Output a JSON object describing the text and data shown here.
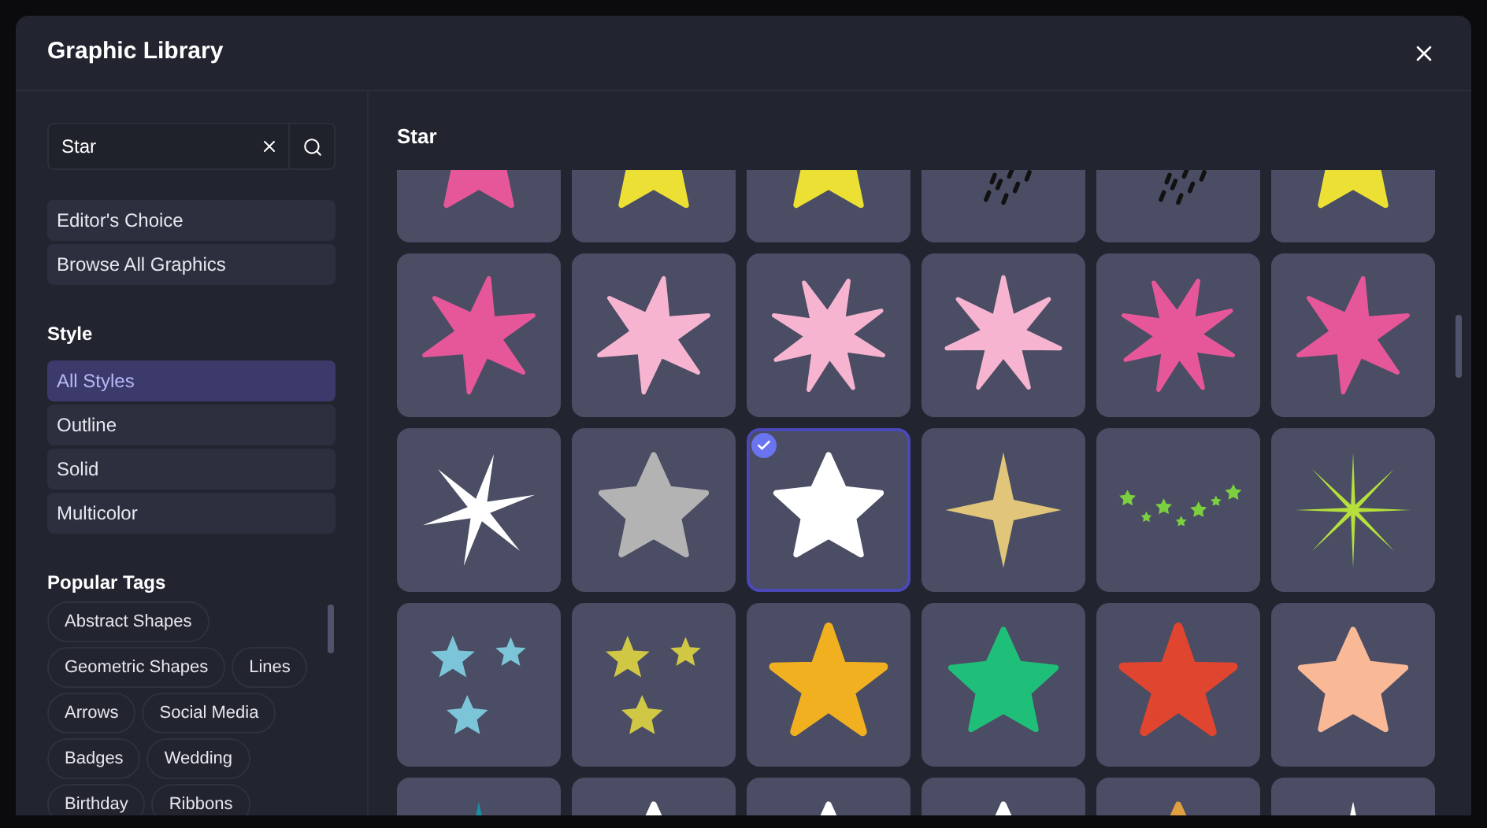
{
  "window": {
    "title": "Graphic Library"
  },
  "search": {
    "value": "Star"
  },
  "collections": [
    {
      "label": "Editor's Choice"
    },
    {
      "label": "Browse All Graphics"
    }
  ],
  "style_heading": "Style",
  "styles": [
    {
      "label": "All Styles",
      "selected": true
    },
    {
      "label": "Outline",
      "selected": false
    },
    {
      "label": "Solid",
      "selected": false
    },
    {
      "label": "Multicolor",
      "selected": false
    }
  ],
  "tags_heading": "Popular Tags",
  "tags": [
    "Abstract Shapes",
    "Geometric Shapes",
    "Lines",
    "Arrows",
    "Social Media",
    "Badges",
    "Wedding",
    "Birthday",
    "Ribbons"
  ],
  "results_title": "Star",
  "tiles": [
    {
      "kind": "star5",
      "color": "#e6579a",
      "selected": false
    },
    {
      "kind": "star5",
      "color": "#ede035",
      "selected": false
    },
    {
      "kind": "star5",
      "color": "#ede035",
      "selected": false
    },
    {
      "kind": "dashes",
      "color": "#111111",
      "selected": false
    },
    {
      "kind": "dashes",
      "color": "#111111",
      "selected": false
    },
    {
      "kind": "star5",
      "color": "#ede035",
      "selected": false
    },
    {
      "kind": "star6",
      "color": "#e6579a",
      "selected": false
    },
    {
      "kind": "star6",
      "color": "#f7b4d0",
      "selected": false
    },
    {
      "kind": "star8",
      "color": "#f7b4d0",
      "selected": false
    },
    {
      "kind": "star7",
      "color": "#f7b4d0",
      "selected": false
    },
    {
      "kind": "star8",
      "color": "#e6579a",
      "selected": false
    },
    {
      "kind": "star6",
      "color": "#e6579a",
      "selected": false
    },
    {
      "kind": "spiky6",
      "color": "#ffffff",
      "selected": false
    },
    {
      "kind": "star5",
      "color": "#b3b3b3",
      "selected": false
    },
    {
      "kind": "star5",
      "color": "#ffffff",
      "selected": true
    },
    {
      "kind": "sparkle4",
      "color": "#e0c57a",
      "selected": false
    },
    {
      "kind": "confetti",
      "color": "#7ccf3f",
      "selected": false
    },
    {
      "kind": "sparkle8",
      "color": "#b5e03c",
      "selected": false
    },
    {
      "kind": "cluster",
      "color": "#7cc4d8",
      "selected": false
    },
    {
      "kind": "cluster",
      "color": "#d0c845",
      "selected": false
    },
    {
      "kind": "starfish",
      "color": "#f0b020",
      "selected": false
    },
    {
      "kind": "star5",
      "color": "#1fbf7a",
      "selected": false
    },
    {
      "kind": "starfish",
      "color": "#e0452f",
      "selected": false
    },
    {
      "kind": "star5",
      "color": "#f9b896",
      "selected": false
    },
    {
      "kind": "sparkle4",
      "color": "#1a8fa0",
      "selected": false
    },
    {
      "kind": "star5",
      "color": "#ffffff",
      "selected": false
    },
    {
      "kind": "star5",
      "color": "#ffffff",
      "selected": false
    },
    {
      "kind": "star5",
      "color": "#ffffff",
      "selected": false
    },
    {
      "kind": "star5",
      "color": "#e0a040",
      "selected": false
    },
    {
      "kind": "sparkle4",
      "color": "#ffffff",
      "selected": false
    }
  ]
}
